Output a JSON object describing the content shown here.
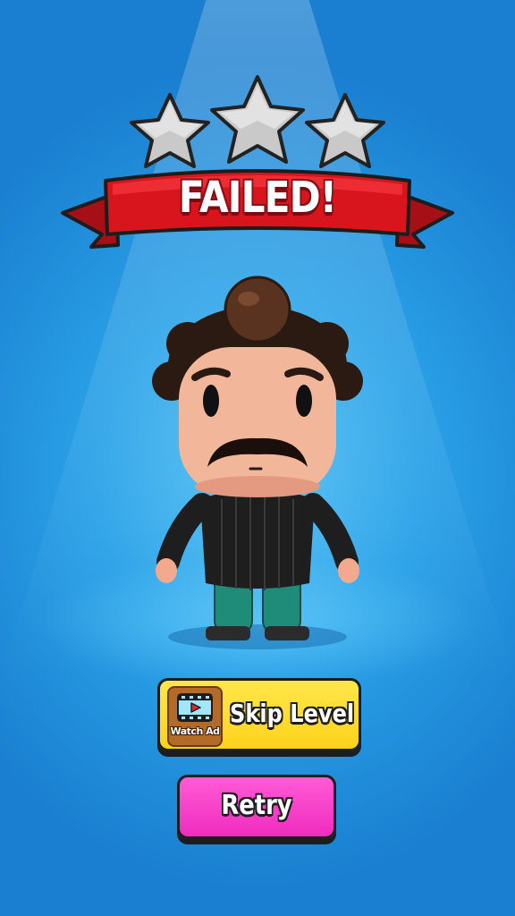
{
  "result": {
    "title": "FAILED!",
    "stars_earned": 0,
    "stars_total": 3
  },
  "buttons": {
    "skip_label": "Skip Level",
    "watch_ad_label": "Watch Ad",
    "retry_label": "Retry"
  },
  "icons": [
    "star-icon",
    "video-ad-icon"
  ],
  "colors": {
    "background": "#2aa2e8",
    "banner_red": "#d8141c",
    "skip_yellow": "#ffd21a",
    "retry_pink": "#f02cbf",
    "star_empty": "#c9c9c9"
  }
}
